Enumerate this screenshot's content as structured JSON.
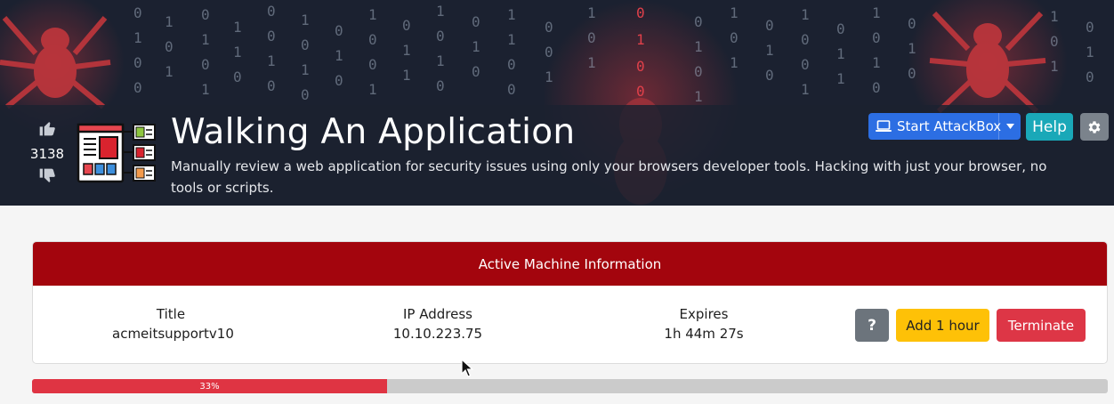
{
  "room": {
    "title": "Walking An Application",
    "description": "Manually review a web application for security issues using only your browsers developer tools. Hacking with just your browser, no tools or scripts.",
    "vote_count": "3138",
    "icons": {
      "upvote": "thumbs-up-icon",
      "downvote": "thumbs-down-icon",
      "room": "web-page-inspect-icon"
    }
  },
  "header_buttons": {
    "attackbox_label": "Start AttackBox",
    "help_label": "Help",
    "icons": {
      "attackbox": "laptop-icon",
      "dropdown": "caret-down-icon",
      "settings": "gear-icon"
    }
  },
  "machine": {
    "header": "Active Machine Information",
    "title_label": "Title",
    "title_value": "acmeitsupportv10",
    "ip_label": "IP Address",
    "ip_value": "10.10.223.75",
    "expires_label": "Expires",
    "expires_value": "1h 44m 27s",
    "help_label": "?",
    "add_hour_label": "Add 1 hour",
    "terminate_label": "Terminate"
  },
  "progress": {
    "value": 0.33,
    "label": "33%"
  },
  "colors": {
    "banner": "#1a1f2b",
    "card_header": "#a3050d",
    "attackbox": "#2c6ee3",
    "help": "#1aa8b8",
    "add_hour": "#fec107",
    "terminate": "#dd3646",
    "progress_fill": "#df3443"
  }
}
